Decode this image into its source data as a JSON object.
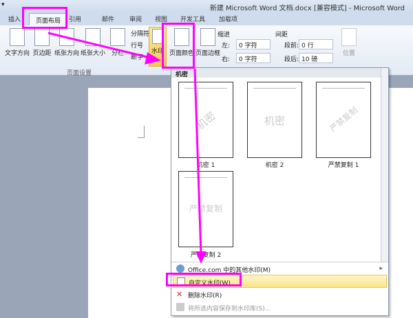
{
  "window": {
    "title": "新建 Microsoft Word 文档.docx [兼容模式] - Microsoft Word"
  },
  "tabs": [
    "插入",
    "页面布局",
    "引用",
    "邮件",
    "审阅",
    "视图",
    "开发工具",
    "加载项"
  ],
  "ribbon": {
    "page_setup": {
      "group_label": "页面设置",
      "buttons": [
        "文字方向",
        "页边距",
        "纸张方向",
        "纸张大小",
        "分栏"
      ],
      "small": [
        "分隔符",
        "行号",
        "断字"
      ]
    },
    "background": {
      "buttons": [
        "水印",
        "页面颜色",
        "页面边框"
      ]
    },
    "indent": {
      "label": "缩进",
      "left_label": "左:",
      "left_value": "0 字符",
      "right_label": "右:",
      "right_value": "0 字符"
    },
    "spacing": {
      "label": "间距",
      "before_label": "段前:",
      "before_value": "0 行",
      "after_label": "段后:",
      "after_value": "10 磅"
    },
    "arrange": {
      "position": "位置"
    }
  },
  "watermark_menu": {
    "section": "机密",
    "items": [
      {
        "label": "机密 1",
        "text": "机密"
      },
      {
        "label": "机密 2",
        "text": "机密"
      },
      {
        "label": "严禁复制 1",
        "text": "严禁复制"
      },
      {
        "label": "严禁复制 2",
        "text": "严禁复制"
      }
    ],
    "commands": [
      "Office.com 中的其他水印(M)",
      "自定义水印(W)...",
      "删除水印(R)",
      "将所选内容保存到水印库(S)..."
    ]
  },
  "colors": {
    "highlight": "#ff00ff",
    "hover": "#fde58a"
  }
}
